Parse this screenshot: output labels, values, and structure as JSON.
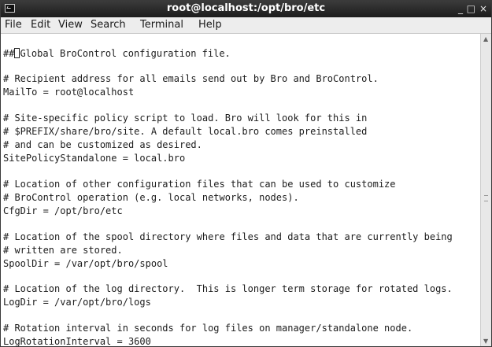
{
  "window": {
    "title": "root@localhost:/opt/bro/etc",
    "minimize": "_",
    "maximize": "□",
    "close": "×"
  },
  "menu": [
    "File",
    "Edit",
    "View",
    "Search",
    "Terminal",
    "Help"
  ],
  "terminal": {
    "first_prefix": "##",
    "first_rest": "Global BroControl configuration file.",
    "lines": [
      "# Recipient address for all emails send out by Bro and BroControl.",
      "MailTo = root@localhost",
      "# Site-specific policy script to load. Bro will look for this in",
      "# $PREFIX/share/bro/site. A default local.bro comes preinstalled",
      "# and can be customized as desired.",
      "SitePolicyStandalone = local.bro",
      "# Location of other configuration files that can be used to customize",
      "# BroControl operation (e.g. local networks, nodes).",
      "CfgDir = /opt/bro/etc",
      "# Location of the spool directory where files and data that are currently being",
      "# written are stored.",
      "SpoolDir = /var/opt/bro/spool",
      "# Location of the log directory.  This is longer term storage for rotated logs.",
      "LogDir = /var/opt/bro/logs",
      "# Rotation interval in seconds for log files on manager/standalone node.",
      "LogRotationInterval = 3600"
    ]
  },
  "scrollbar": {
    "up": "▲",
    "down": "▼"
  }
}
